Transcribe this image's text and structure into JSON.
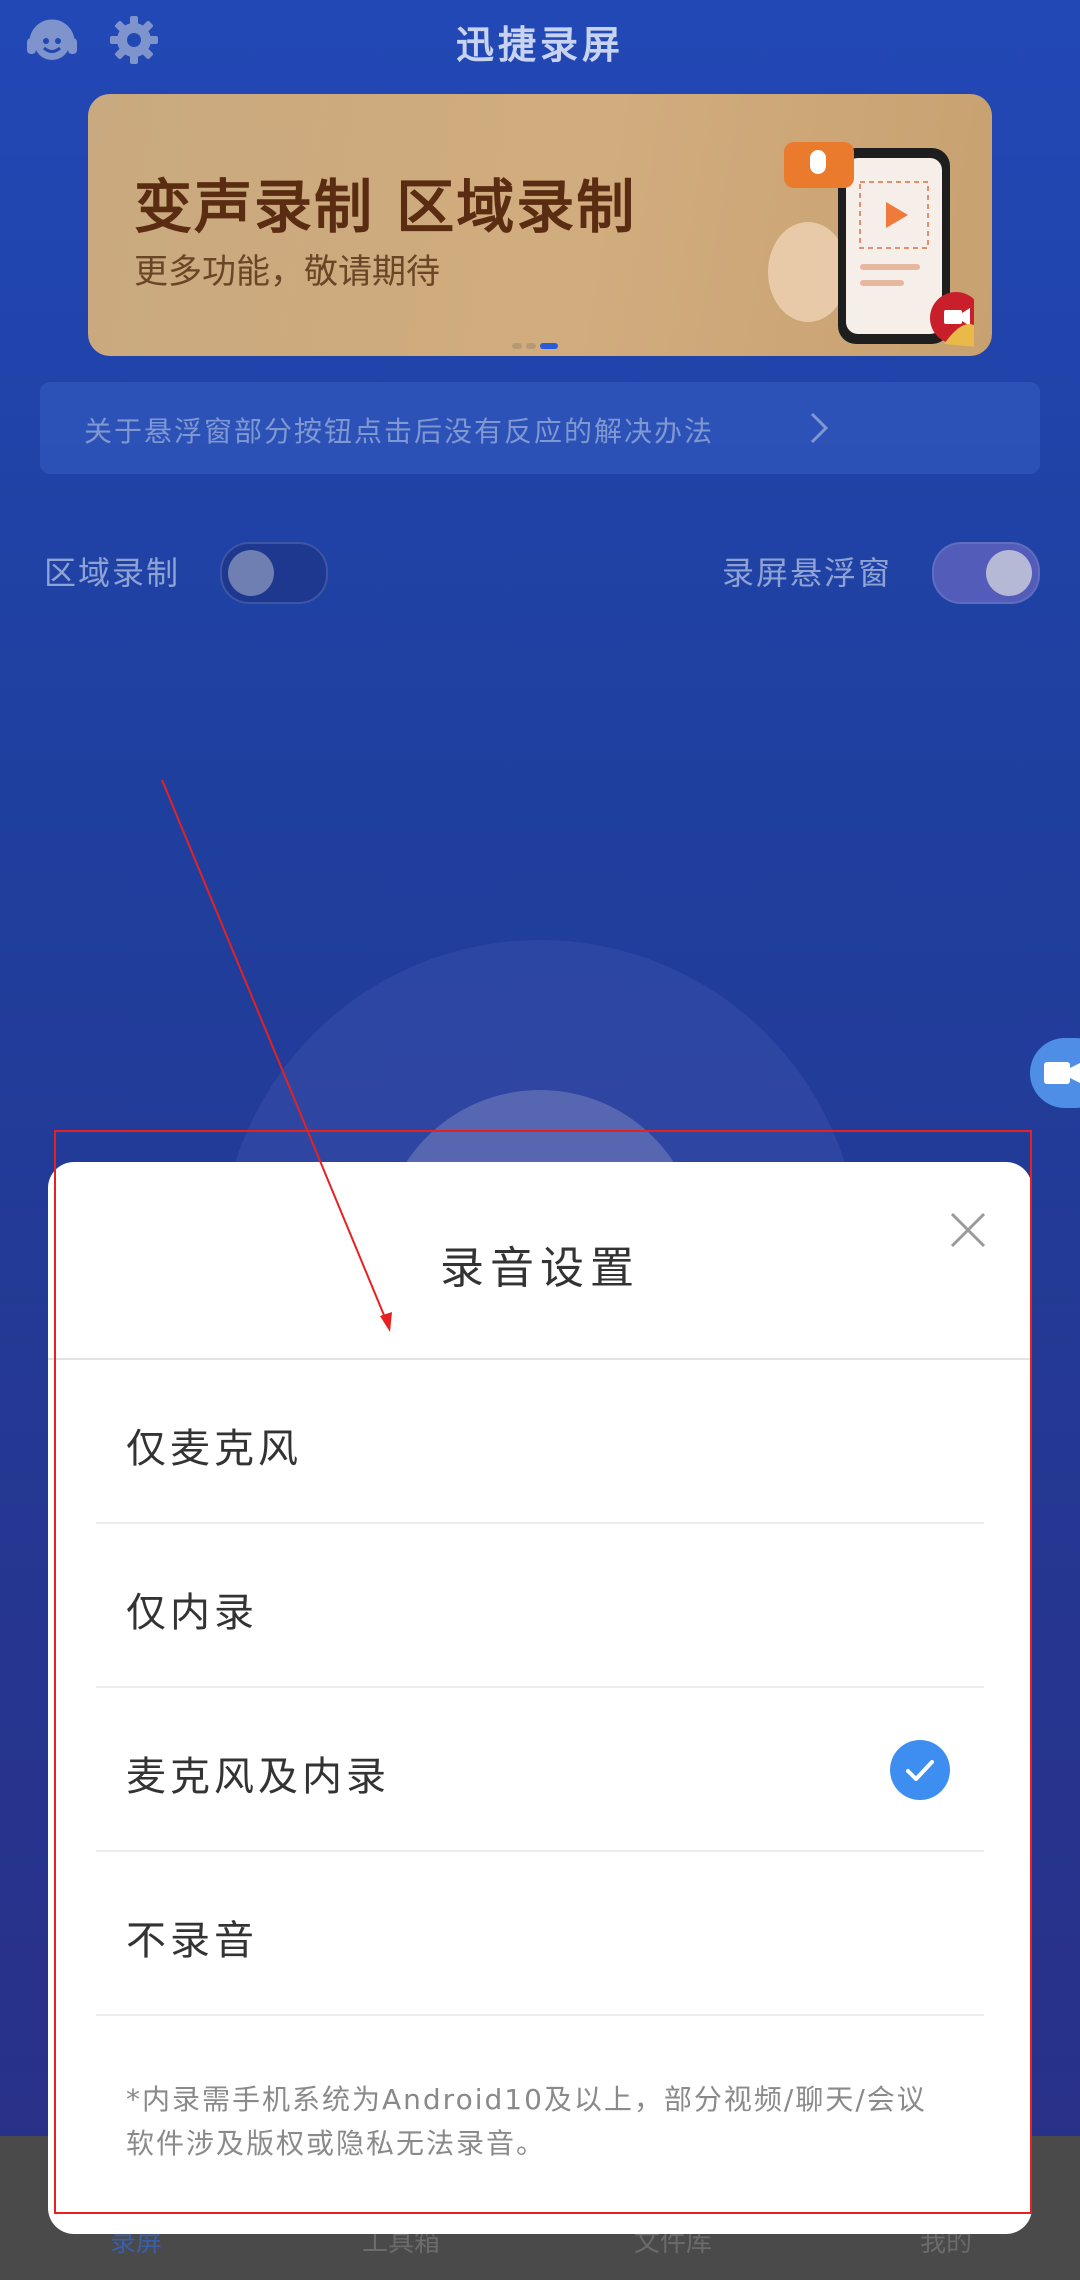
{
  "app": {
    "title": "迅捷录屏"
  },
  "topbar": {
    "left_icons": [
      "headset-icon",
      "gear-icon"
    ]
  },
  "banner": {
    "headline": "变声录制 区域录制",
    "subtitle": "更多功能，敬请期待",
    "page_count": 3,
    "active_page": 3
  },
  "notice": {
    "text": "关于悬浮窗部分按钮点击后没有反应的解决办法"
  },
  "toggles": {
    "region_record_label": "区域录制",
    "region_record_on": false,
    "float_window_label": "录屏悬浮窗",
    "float_window_on": true
  },
  "bottom_nav": [
    "录屏",
    "工具箱",
    "文件库",
    "我的"
  ],
  "sheet": {
    "title": "录音设置",
    "options": [
      {
        "label": "仅麦克风",
        "selected": false
      },
      {
        "label": "仅内录",
        "selected": false
      },
      {
        "label": "麦克风及内录",
        "selected": true
      },
      {
        "label": "不录音",
        "selected": false
      }
    ],
    "note_line1": "*内录需手机系统为Android10及以上，部分视频/聊天/会议",
    "note_line2": "软件涉及版权或隐私无法录音。"
  },
  "colors": {
    "accent_blue": "#3d8ef0",
    "annotation_red": "#e52222"
  }
}
